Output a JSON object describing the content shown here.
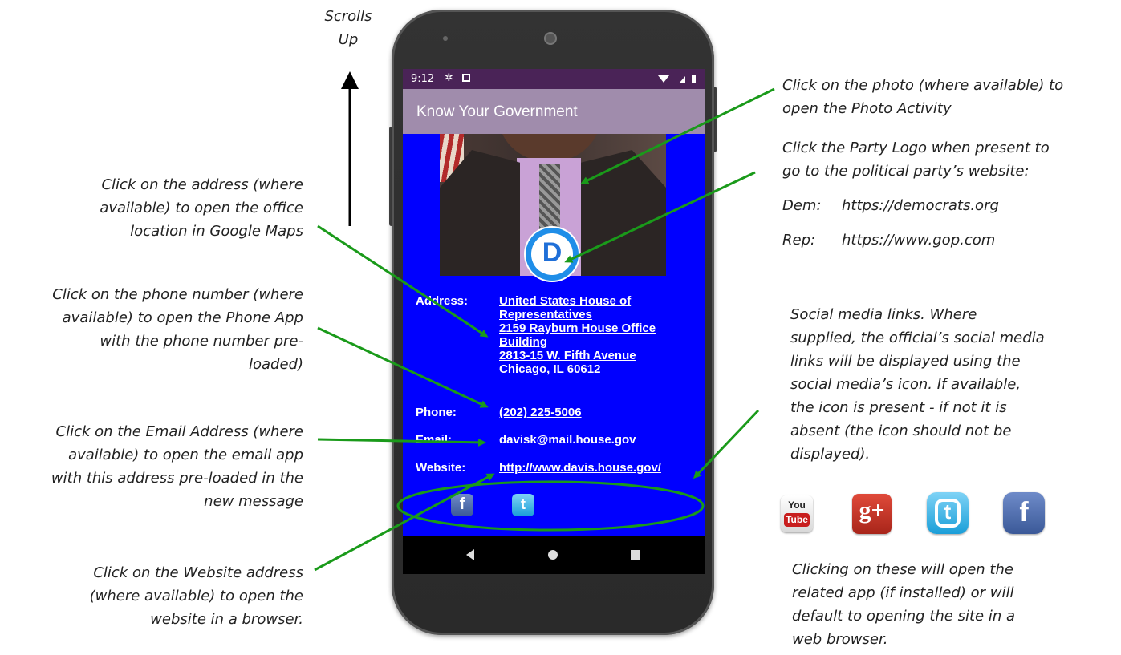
{
  "annotations": {
    "scrolls_up": [
      "Scrolls",
      "Up"
    ],
    "photo_activity": [
      "Click on the photo (where available) to",
      "open the Photo Activity"
    ],
    "party_logo": [
      "Click the Party Logo when present to",
      "go to the political party’s website:"
    ],
    "dem_label": "Dem:",
    "dem_url": "https://democrats.org",
    "rep_label": "Rep:",
    "rep_url": "https://www.gop.com",
    "address_note": [
      "Click on the address (where",
      "available) to open the office",
      "location in Google Maps"
    ],
    "phone_note": [
      "Click on the phone number (where",
      "available) to open the Phone App",
      "with the phone number pre-",
      "loaded)"
    ],
    "email_note": [
      "Click on the Email Address (where",
      "available) to open the email app",
      "with this address pre-loaded in the",
      "new message"
    ],
    "website_note": [
      "Click on the Website address",
      "(where available) to open the",
      "website in a browser."
    ],
    "social_note": [
      "Social media links. Where",
      "supplied, the official’s social media",
      "links will be displayed using the",
      "social media’s icon. If available,",
      "the icon is present - if not it is",
      "absent (the icon should not be",
      "displayed)."
    ],
    "clicking_note": [
      "Clicking on these will open the",
      "related app (if installed) or will",
      "default to opening the site in a",
      "web browser."
    ]
  },
  "phone": {
    "status_time": "9:12",
    "app_title": "Know Your Government",
    "party_logo_letter": "D",
    "address_label": "Address:",
    "address_lines": [
      "United States House of",
      "Representatives",
      "2159 Rayburn House Office",
      "Building",
      "2813-15 W. Fifth Avenue",
      "Chicago, IL 60612"
    ],
    "phone_label": "Phone:",
    "phone_value": "(202) 225-5006",
    "email_label": "Email:",
    "email_value": "davisk@mail.house.gov",
    "website_label": "Website:",
    "website_value": "http://www.davis.house.gov/"
  },
  "social_icons": {
    "youtube_line1": "You",
    "youtube_line2": "Tube",
    "googleplus": "g+",
    "twitter": "t",
    "facebook": "f"
  },
  "colors": {
    "screen_bg": "#0000ff",
    "app_bar": "#a08cac",
    "status_bar": "#4a2357",
    "arrow_green": "#1a9a1a"
  }
}
